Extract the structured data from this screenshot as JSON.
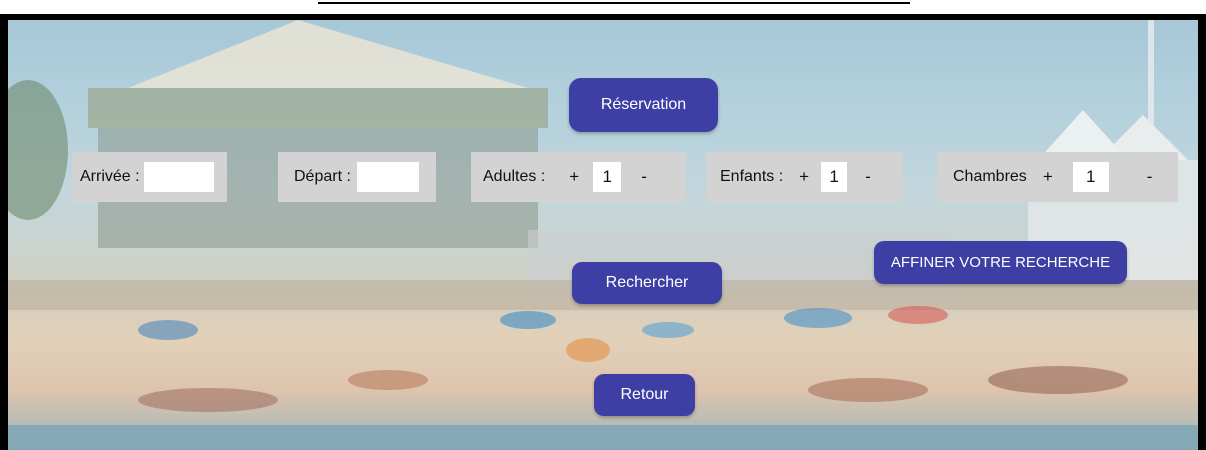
{
  "header": {
    "title": "Réservation"
  },
  "form": {
    "arrivee": {
      "label": "Arrivée :",
      "value": ""
    },
    "depart": {
      "label": "Départ :",
      "value": ""
    },
    "adultes": {
      "label": "Adultes :",
      "plus": "+",
      "value": "1",
      "minus": "-"
    },
    "enfants": {
      "label": "Enfants :",
      "plus": "+",
      "value": "1",
      "minus": "-"
    },
    "chambres": {
      "label": "Chambres",
      "plus": "+",
      "value": "1",
      "minus": "-"
    }
  },
  "actions": {
    "search": "Rechercher",
    "refine": "AFFINER VOTRE RECHERCHE",
    "back": "Retour"
  },
  "colors": {
    "button": "#3d3fa5",
    "panel": "#d3d3d3"
  }
}
